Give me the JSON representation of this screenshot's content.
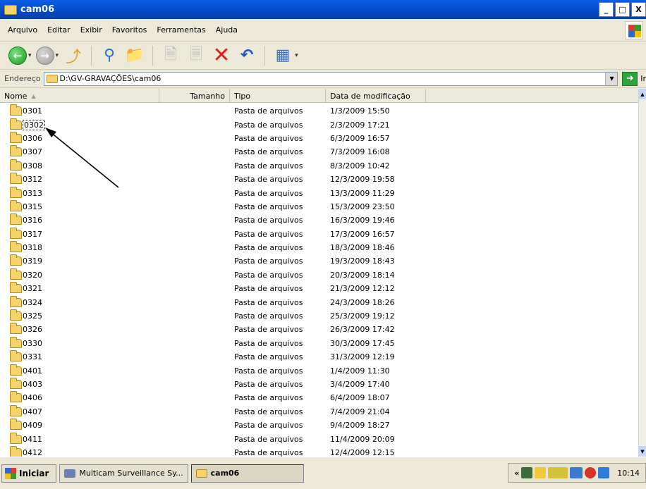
{
  "window": {
    "title": "cam06",
    "buttons": [
      "_",
      "□",
      "X"
    ]
  },
  "menu": [
    "Arquivo",
    "Editar",
    "Exibir",
    "Favoritos",
    "Ferramentas",
    "Ajuda"
  ],
  "address": {
    "label": "Endereço",
    "path": "D:\\GV-GRAVAÇÕES\\cam06",
    "go_label": "Ir"
  },
  "columns": {
    "name": "Nome",
    "size": "Tamanho",
    "type": "Tipo",
    "date": "Data de modificação"
  },
  "rows": [
    {
      "name": "0301",
      "type": "Pasta de arquivos",
      "date": "1/3/2009 15:50"
    },
    {
      "name": "0302",
      "type": "Pasta de arquivos",
      "date": "2/3/2009 17:21"
    },
    {
      "name": "0306",
      "type": "Pasta de arquivos",
      "date": "6/3/2009 16:57"
    },
    {
      "name": "0307",
      "type": "Pasta de arquivos",
      "date": "7/3/2009 16:08"
    },
    {
      "name": "0308",
      "type": "Pasta de arquivos",
      "date": "8/3/2009 10:42"
    },
    {
      "name": "0312",
      "type": "Pasta de arquivos",
      "date": "12/3/2009 19:58"
    },
    {
      "name": "0313",
      "type": "Pasta de arquivos",
      "date": "13/3/2009 11:29"
    },
    {
      "name": "0315",
      "type": "Pasta de arquivos",
      "date": "15/3/2009 23:50"
    },
    {
      "name": "0316",
      "type": "Pasta de arquivos",
      "date": "16/3/2009 19:46"
    },
    {
      "name": "0317",
      "type": "Pasta de arquivos",
      "date": "17/3/2009 16:57"
    },
    {
      "name": "0318",
      "type": "Pasta de arquivos",
      "date": "18/3/2009 18:46"
    },
    {
      "name": "0319",
      "type": "Pasta de arquivos",
      "date": "19/3/2009 18:43"
    },
    {
      "name": "0320",
      "type": "Pasta de arquivos",
      "date": "20/3/2009 18:14"
    },
    {
      "name": "0321",
      "type": "Pasta de arquivos",
      "date": "21/3/2009 12:12"
    },
    {
      "name": "0324",
      "type": "Pasta de arquivos",
      "date": "24/3/2009 18:26"
    },
    {
      "name": "0325",
      "type": "Pasta de arquivos",
      "date": "25/3/2009 19:12"
    },
    {
      "name": "0326",
      "type": "Pasta de arquivos",
      "date": "26/3/2009 17:42"
    },
    {
      "name": "0330",
      "type": "Pasta de arquivos",
      "date": "30/3/2009 17:45"
    },
    {
      "name": "0331",
      "type": "Pasta de arquivos",
      "date": "31/3/2009 12:19"
    },
    {
      "name": "0401",
      "type": "Pasta de arquivos",
      "date": "1/4/2009 11:30"
    },
    {
      "name": "0403",
      "type": "Pasta de arquivos",
      "date": "3/4/2009 17:40"
    },
    {
      "name": "0406",
      "type": "Pasta de arquivos",
      "date": "6/4/2009 18:07"
    },
    {
      "name": "0407",
      "type": "Pasta de arquivos",
      "date": "7/4/2009 21:04"
    },
    {
      "name": "0409",
      "type": "Pasta de arquivos",
      "date": "9/4/2009 18:27"
    },
    {
      "name": "0411",
      "type": "Pasta de arquivos",
      "date": "11/4/2009 20:09"
    },
    {
      "name": "0412",
      "type": "Pasta de arquivos",
      "date": "12/4/2009 12:15"
    }
  ],
  "selected_row": "0302",
  "taskbar": {
    "start_label": "Iniciar",
    "tasks": [
      "Multicam Surveillance Sy...",
      "cam06"
    ],
    "clock": "10:14"
  },
  "colors": {
    "titlebar": "#0148c4",
    "folder": "#f6d36b",
    "go_button": "#2ea43a"
  },
  "icons": [
    "back-icon",
    "forward-icon",
    "up-icon",
    "search-icon",
    "folders-icon",
    "move-to-icon",
    "copy-to-icon",
    "delete-icon",
    "undo-icon",
    "views-icon"
  ]
}
